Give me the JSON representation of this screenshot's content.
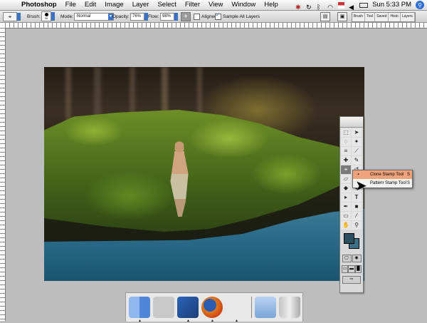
{
  "menubar": {
    "app": "Photoshop",
    "items": [
      "File",
      "Edit",
      "Image",
      "Layer",
      "Select",
      "Filter",
      "View",
      "Window",
      "Help"
    ],
    "clock": "Sun 5:33 PM"
  },
  "options": {
    "brush_label": "Brush:",
    "brush_size": "55",
    "mode_label": "Mode:",
    "mode_value": "Normal",
    "opacity_label": "Opacity:",
    "opacity_value": "76%",
    "flow_label": "Flow:",
    "flow_value": "98%",
    "aligned_label": "Aligned",
    "sample_all_label": "Sample All Layers",
    "palette_tabs": [
      "Brush",
      "Tool",
      "Saved",
      "Histo",
      "Layers"
    ]
  },
  "tools": {
    "flyout": [
      {
        "label": "Clone Stamp Tool",
        "key": "S"
      },
      {
        "label": "Pattern Stamp Tool",
        "key": "S"
      }
    ]
  },
  "colors": {
    "foreground": "#2d4f62",
    "background": "#3b6f85",
    "highlight": "#f0a27c"
  },
  "dock": {
    "items": [
      "finder-icon",
      "system-preferences-icon",
      "photoshop-icon",
      "firefox-icon",
      "script-editor-icon",
      "folder-icon",
      "trash-icon"
    ]
  }
}
